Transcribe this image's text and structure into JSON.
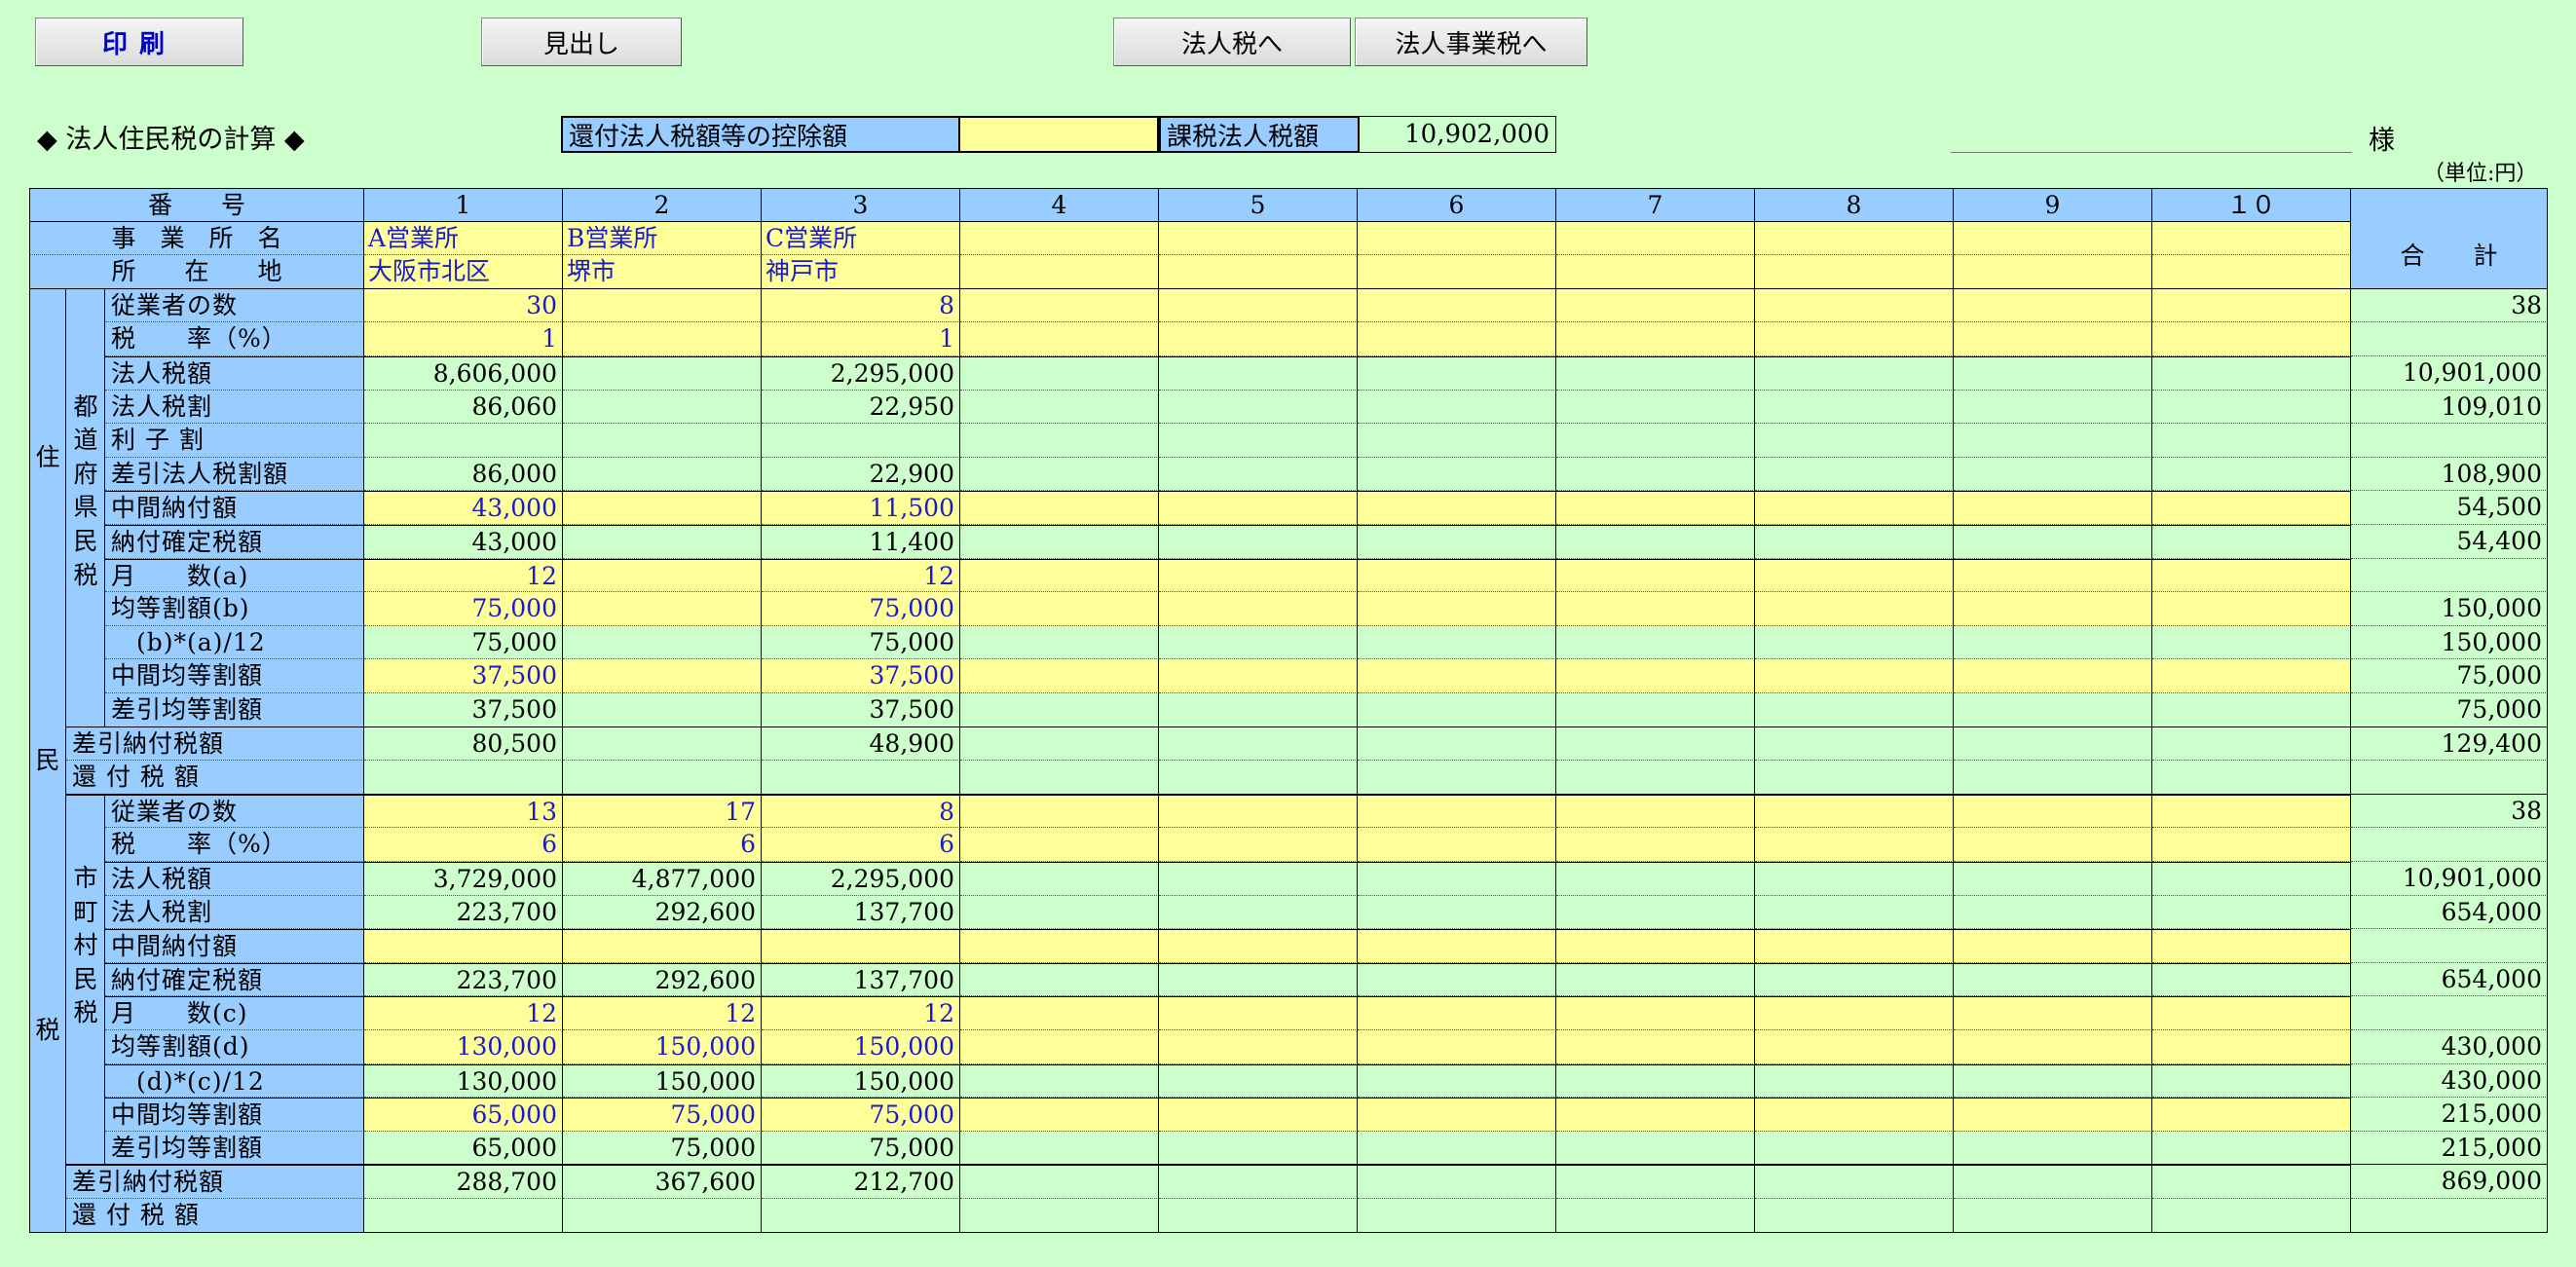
{
  "buttons": {
    "print": "印刷",
    "midashi": "見出し",
    "houjinzei": "法人税へ",
    "jigyouzei": "法人事業税へ"
  },
  "header": {
    "title": "◆ 法人住民税の計算 ◆",
    "deduction_label": "還付法人税額等の控除額",
    "deduction_value": "",
    "taxable_label": "課税法人税額",
    "taxable_value": "10,902,000",
    "sama": "様",
    "unit": "（単位:円）"
  },
  "table": {
    "corner_number": "番　　号",
    "corner_office": "事　業　所　名",
    "corner_location": "所　　在　　地",
    "total_header": "合　　計",
    "columns": [
      "1",
      "2",
      "3",
      "4",
      "5",
      "6",
      "7",
      "8",
      "9",
      "１０"
    ],
    "offices": [
      "A営業所",
      "B営業所",
      "C営業所",
      "",
      "",
      "",
      "",
      "",
      "",
      ""
    ],
    "locations": [
      "大阪市北区",
      "堺市",
      "神戸市",
      "",
      "",
      "",
      "",
      "",
      "",
      ""
    ],
    "group_outer_top": "住",
    "group_outer_mid": "民",
    "group_outer_bottom": "税",
    "group_pref": [
      "都",
      "道",
      "府",
      "県",
      "民",
      "税"
    ],
    "group_city": [
      "市",
      "町",
      "村",
      "民",
      "税"
    ],
    "rows": [
      {
        "label": "従業者の数",
        "values": [
          "30",
          "",
          "8"
        ],
        "total": "38",
        "input": true
      },
      {
        "label": "税　　率（%）",
        "values": [
          "1",
          "",
          "1"
        ],
        "total": "",
        "input": true
      },
      {
        "label": "法人税額",
        "values": [
          "8,606,000",
          "",
          "2,295,000"
        ],
        "total": "10,901,000",
        "input": false
      },
      {
        "label": "法人税割",
        "values": [
          "86,060",
          "",
          "22,950"
        ],
        "total": "109,010",
        "input": false
      },
      {
        "label": "利 子 割",
        "values": [
          "",
          "",
          ""
        ],
        "total": "",
        "input": false
      },
      {
        "label": "差引法人税割額",
        "values": [
          "86,000",
          "",
          "22,900"
        ],
        "total": "108,900",
        "input": false
      },
      {
        "label": "中間納付額",
        "values": [
          "43,000",
          "",
          "11,500"
        ],
        "total": "54,500",
        "input": true
      },
      {
        "label": "納付確定税額",
        "values": [
          "43,000",
          "",
          "11,400"
        ],
        "total": "54,400",
        "input": false
      },
      {
        "label": "月　　数(a)",
        "values": [
          "12",
          "",
          "12"
        ],
        "total": "",
        "input": true
      },
      {
        "label": "均等割額(b)",
        "values": [
          "75,000",
          "",
          "75,000"
        ],
        "total": "150,000",
        "input": true
      },
      {
        "label": "　(b)*(a)/12",
        "values": [
          "75,000",
          "",
          "75,000"
        ],
        "total": "150,000",
        "input": false
      },
      {
        "label": "中間均等割額",
        "values": [
          "37,500",
          "",
          "37,500"
        ],
        "total": "75,000",
        "input": true
      },
      {
        "label": "差引均等割額",
        "values": [
          "37,500",
          "",
          "37,500"
        ],
        "total": "75,000",
        "input": false
      },
      {
        "label": "差引納付税額",
        "values": [
          "80,500",
          "",
          "48,900"
        ],
        "total": "129,400",
        "input": false
      },
      {
        "label": "還 付 税 額",
        "values": [
          "",
          "",
          ""
        ],
        "total": "",
        "input": false
      },
      {
        "label": "従業者の数",
        "values": [
          "13",
          "17",
          "8"
        ],
        "total": "38",
        "input": true
      },
      {
        "label": "税　　率（%）",
        "values": [
          "6",
          "6",
          "6"
        ],
        "total": "",
        "input": true
      },
      {
        "label": "法人税額",
        "values": [
          "3,729,000",
          "4,877,000",
          "2,295,000"
        ],
        "total": "10,901,000",
        "input": false
      },
      {
        "label": "法人税割",
        "values": [
          "223,700",
          "292,600",
          "137,700"
        ],
        "total": "654,000",
        "input": false
      },
      {
        "label": "中間納付額",
        "values": [
          "",
          "",
          ""
        ],
        "total": "",
        "input": true
      },
      {
        "label": "納付確定税額",
        "values": [
          "223,700",
          "292,600",
          "137,700"
        ],
        "total": "654,000",
        "input": false
      },
      {
        "label": "月　　数(c)",
        "values": [
          "12",
          "12",
          "12"
        ],
        "total": "",
        "input": true
      },
      {
        "label": "均等割額(d)",
        "values": [
          "130,000",
          "150,000",
          "150,000"
        ],
        "total": "430,000",
        "input": true
      },
      {
        "label": "　(d)*(c)/12",
        "values": [
          "130,000",
          "150,000",
          "150,000"
        ],
        "total": "430,000",
        "input": false
      },
      {
        "label": "中間均等割額",
        "values": [
          "65,000",
          "75,000",
          "75,000"
        ],
        "total": "215,000",
        "input": true
      },
      {
        "label": "差引均等割額",
        "values": [
          "65,000",
          "75,000",
          "75,000"
        ],
        "total": "215,000",
        "input": false
      },
      {
        "label": "差引納付税額",
        "values": [
          "288,700",
          "367,600",
          "212,700"
        ],
        "total": "869,000",
        "input": false
      },
      {
        "label": "還 付 税 額",
        "values": [
          "",
          "",
          ""
        ],
        "total": "",
        "input": false
      }
    ]
  },
  "colors": {
    "background": "#ccffcc",
    "header_blue": "#99ccff",
    "input_yellow": "#ffff99",
    "input_text": "#1a1acc"
  }
}
